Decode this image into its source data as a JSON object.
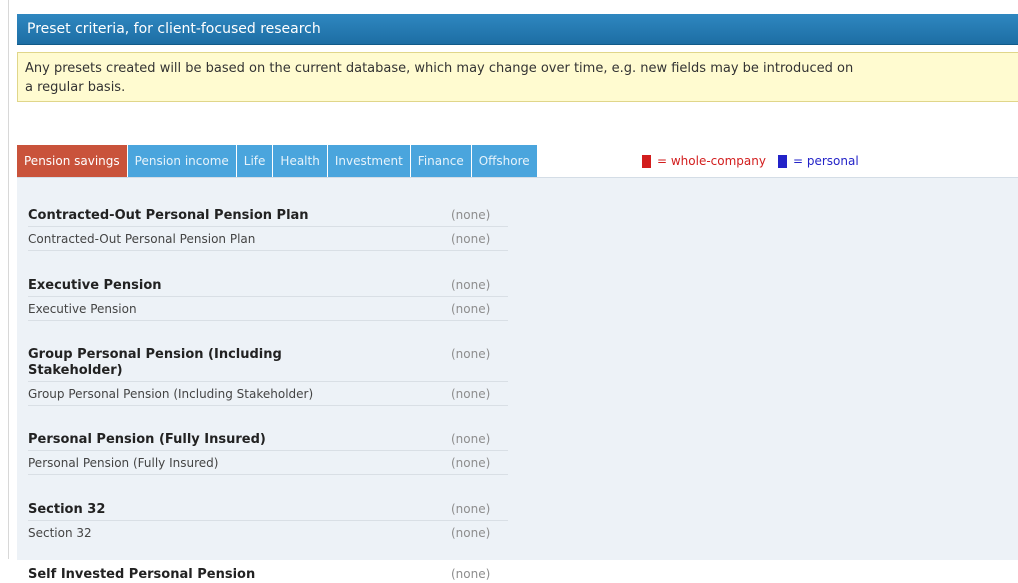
{
  "header": {
    "title": "Preset criteria, for client-focused research"
  },
  "notice": {
    "line1": "Any presets created will be based on the current database, which may change over time, e.g. new fields may be introduced on",
    "line2": "a regular basis."
  },
  "tabs": [
    {
      "label": "Pension savings",
      "active": true
    },
    {
      "label": "Pension income"
    },
    {
      "label": "Life"
    },
    {
      "label": "Health"
    },
    {
      "label": "Investment"
    },
    {
      "label": "Finance"
    },
    {
      "label": "Offshore"
    }
  ],
  "legend": {
    "company": "= whole-company",
    "personal": "= personal",
    "company_color": "#d21d1d",
    "personal_color": "#2323c8"
  },
  "groups": [
    {
      "title": "Contracted-Out Personal Pension Plan",
      "title_value": "(none)",
      "item": "Contracted-Out Personal Pension Plan",
      "item_value": "(none)"
    },
    {
      "title": "Executive Pension",
      "title_value": "(none)",
      "item": "Executive Pension",
      "item_value": "(none)"
    },
    {
      "title": "Group Personal Pension (Including Stakeholder)",
      "title_value": "(none)",
      "item": "Group Personal Pension (Including Stakeholder)",
      "item_value": "(none)"
    },
    {
      "title": "Personal Pension (Fully Insured)",
      "title_value": "(none)",
      "item": "Personal Pension (Fully Insured)",
      "item_value": "(none)"
    },
    {
      "title": "Section 32",
      "title_value": "(none)",
      "item": "Section 32",
      "item_value": "(none)"
    },
    {
      "title": "Self Invested Personal Pension",
      "title_value": "(none)"
    }
  ]
}
